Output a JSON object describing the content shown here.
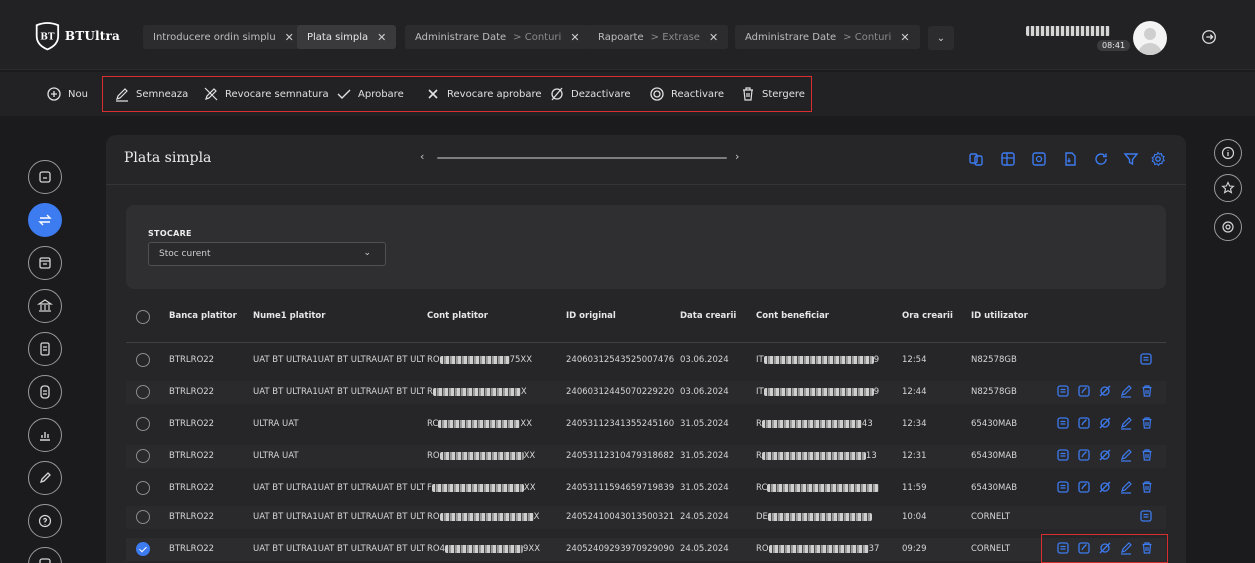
{
  "app": {
    "logo_text": "BTUltra"
  },
  "tabs": [
    {
      "label": "Introducere ordin simplu",
      "sub": ""
    },
    {
      "label": "Plata simpla",
      "sub": ""
    },
    {
      "label": "Administrare Date",
      "sub": "> Conturi"
    },
    {
      "label": "Rapoarte",
      "sub": "> Extrase"
    },
    {
      "label": "Administrare Date",
      "sub": "> Conturi"
    }
  ],
  "user": {
    "time": "08:41"
  },
  "actions": {
    "nou": "Nou",
    "semneaza": "Semneaza",
    "revocare_semnatura": "Revocare semnatura",
    "aprobare": "Aprobare",
    "revocare_aprobare": "Revocare aprobare",
    "dezactivare": "Dezactivare",
    "reactivare": "Reactivare",
    "stergere": "Stergere"
  },
  "page": {
    "title": "Plata simpla"
  },
  "filter": {
    "label": "STOCARE",
    "value": "Stoc curent"
  },
  "table": {
    "headers": {
      "banca": "Banca platitor",
      "nume": "Nume1 platitor",
      "cont": "Cont platitor",
      "id_original": "ID original",
      "data": "Data crearii",
      "cont_benef": "Cont beneficiar",
      "ora": "Ora crearii",
      "utilizator": "ID utilizator"
    },
    "rows": [
      {
        "banca": "BTRLRO22",
        "nume": "UAT BT ULTRA1UAT BT ULTRAUAT BT ULT",
        "cont_pre": "RO",
        "cont_suf": "75XX",
        "id_original": "24060312543525007476",
        "data": "03.06.2024",
        "benef_pre": "IT",
        "benef_suf": "9",
        "ora": "12:54",
        "utilizator": "N82578GB"
      },
      {
        "banca": "BTRLRO22",
        "nume": "UAT BT ULTRA1UAT BT ULTRAUAT BT ULT",
        "cont_pre": "R",
        "cont_suf": "X",
        "id_original": "24060312445070229220",
        "data": "03.06.2024",
        "benef_pre": "IT",
        "benef_suf": "9",
        "ora": "12:44",
        "utilizator": "N82578GB"
      },
      {
        "banca": "BTRLRO22",
        "nume": "ULTRA UAT",
        "cont_pre": "RC",
        "cont_suf": "XX",
        "id_original": "24053112341355245160",
        "data": "31.05.2024",
        "benef_pre": "R",
        "benef_suf": "43",
        "ora": "12:34",
        "utilizator": "65430MAB"
      },
      {
        "banca": "BTRLRO22",
        "nume": "ULTRA UAT",
        "cont_pre": "RO",
        "cont_suf": "XX",
        "id_original": "24053112310479318682",
        "data": "31.05.2024",
        "benef_pre": "R",
        "benef_suf": "13",
        "ora": "12:31",
        "utilizator": "65430MAB"
      },
      {
        "banca": "BTRLRO22",
        "nume": "UAT BT ULTRA1UAT BT ULTRAUAT BT ULT",
        "cont_pre": "F",
        "cont_suf": "XX",
        "id_original": "24053111594659719839",
        "data": "31.05.2024",
        "benef_pre": "RC",
        "benef_suf": "",
        "ora": "11:59",
        "utilizator": "65430MAB"
      },
      {
        "banca": "BTRLRO22",
        "nume": "UAT BT ULTRA1UAT BT ULTRAUAT BT ULT",
        "cont_pre": "RO",
        "cont_suf": "X",
        "id_original": "24052410043013500321",
        "data": "24.05.2024",
        "benef_pre": "DE",
        "benef_suf": "",
        "ora": "10:04",
        "utilizator": "CORNELT"
      },
      {
        "banca": "BTRLRO22",
        "nume": "UAT BT ULTRA1UAT BT ULTRAUAT BT ULT",
        "cont_pre": "RO4",
        "cont_suf": "9XX",
        "id_original": "24052409293970929090",
        "data": "24.05.2024",
        "benef_pre": "RO",
        "benef_suf": "37",
        "ora": "09:29",
        "utilizator": "CORNELT"
      }
    ]
  }
}
